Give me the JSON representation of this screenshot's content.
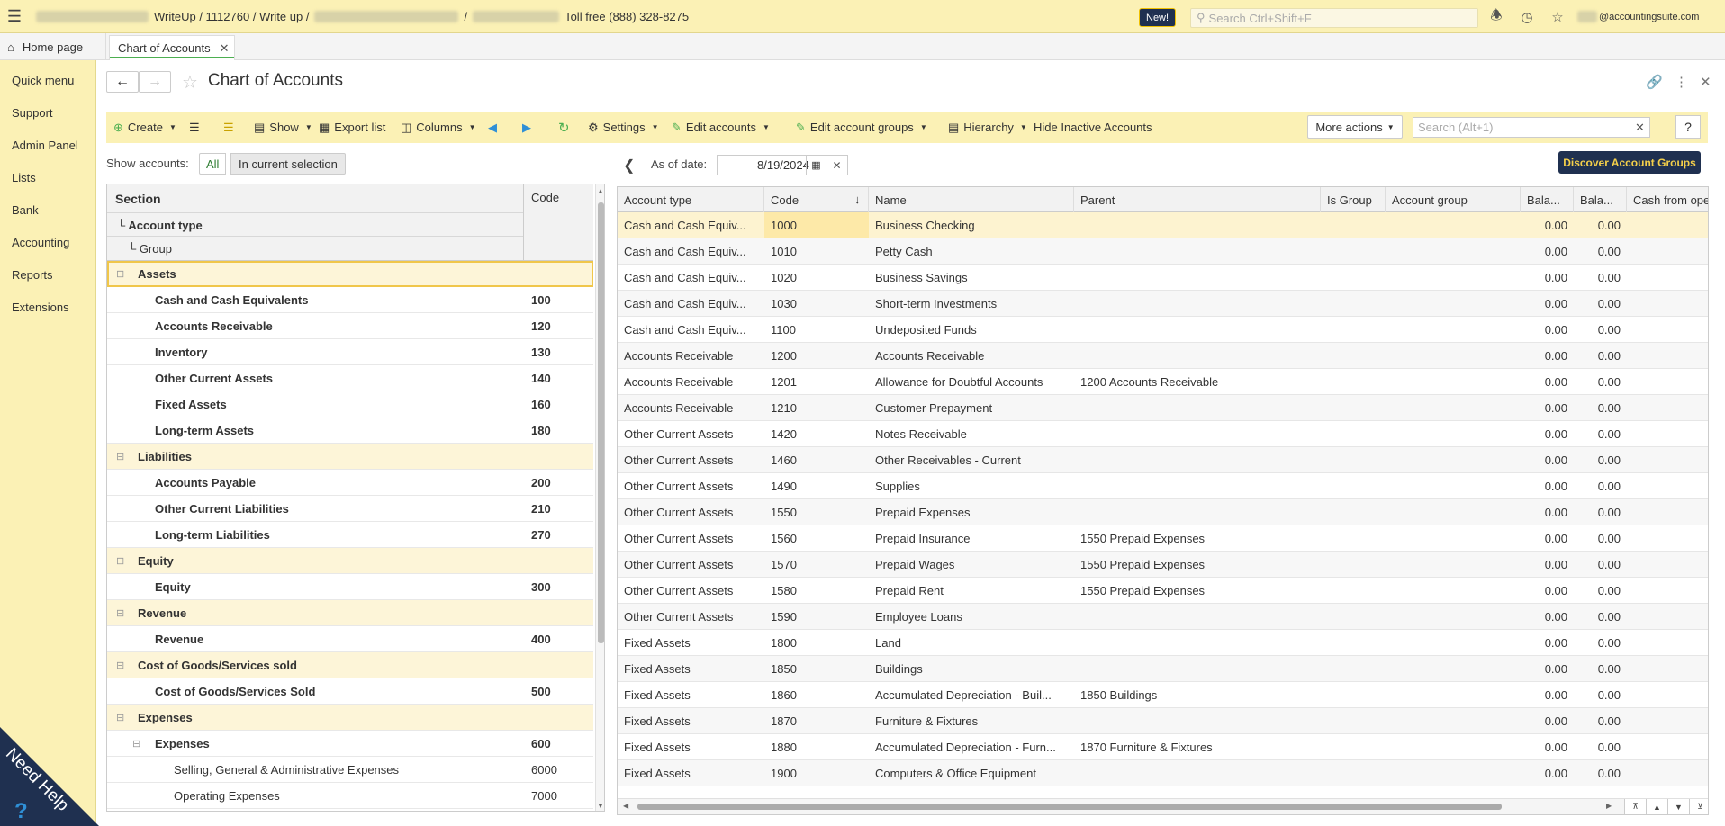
{
  "topbar": {
    "breadcrumb_app": "WriteUp / 1112760 / Write up /",
    "breadcrumb_sep": "/",
    "phone": "Toll free (888) 328-8275",
    "new_badge": "New!",
    "search_placeholder": "Search Ctrl+Shift+F",
    "user_email": "@accountingsuite.com"
  },
  "tabs": {
    "home": "Home page",
    "active": "Chart of Accounts"
  },
  "sidebar": {
    "items": [
      "Quick menu",
      "Support",
      "Admin Panel",
      "Lists",
      "Bank",
      "Accounting",
      "Reports",
      "Extensions"
    ],
    "need_help": "Need Help",
    "need_help_q": "?"
  },
  "page": {
    "title": "Chart of Accounts"
  },
  "toolbar": {
    "create": "Create",
    "show": "Show",
    "export_list": "Export list",
    "columns": "Columns",
    "settings": "Settings",
    "edit_accounts": "Edit accounts",
    "edit_account_groups": "Edit account groups",
    "hierarchy": "Hierarchy",
    "hide_inactive": "Hide Inactive Accounts",
    "more_actions": "More actions",
    "search_placeholder": "Search (Alt+1)",
    "help": "?"
  },
  "show_accounts": {
    "label": "Show accounts:",
    "all": "All",
    "in_current_selection": "In current selection"
  },
  "left_table": {
    "header_section": "Section",
    "header_code": "Code",
    "header_account_type": "└ Account type",
    "header_group": "└ Group",
    "rows": [
      {
        "name": "Assets",
        "code": "",
        "level": 0,
        "bold": true,
        "toggle": "⊟"
      },
      {
        "name": "Cash and Cash Equivalents",
        "code": "100",
        "level": 1,
        "bold": true,
        "toggle": ""
      },
      {
        "name": "Accounts Receivable",
        "code": "120",
        "level": 1,
        "bold": true,
        "toggle": ""
      },
      {
        "name": "Inventory",
        "code": "130",
        "level": 1,
        "bold": true,
        "toggle": ""
      },
      {
        "name": "Other Current Assets",
        "code": "140",
        "level": 1,
        "bold": true,
        "toggle": ""
      },
      {
        "name": "Fixed Assets",
        "code": "160",
        "level": 1,
        "bold": true,
        "toggle": ""
      },
      {
        "name": "Long-term Assets",
        "code": "180",
        "level": 1,
        "bold": true,
        "toggle": ""
      },
      {
        "name": "Liabilities",
        "code": "",
        "level": 0,
        "bold": true,
        "toggle": "⊟"
      },
      {
        "name": "Accounts Payable",
        "code": "200",
        "level": 1,
        "bold": true,
        "toggle": ""
      },
      {
        "name": "Other Current Liabilities",
        "code": "210",
        "level": 1,
        "bold": true,
        "toggle": ""
      },
      {
        "name": "Long-term Liabilities",
        "code": "270",
        "level": 1,
        "bold": true,
        "toggle": ""
      },
      {
        "name": "Equity",
        "code": "",
        "level": 0,
        "bold": true,
        "toggle": "⊟"
      },
      {
        "name": "Equity",
        "code": "300",
        "level": 1,
        "bold": true,
        "toggle": ""
      },
      {
        "name": "Revenue",
        "code": "",
        "level": 0,
        "bold": true,
        "toggle": "⊟"
      },
      {
        "name": "Revenue",
        "code": "400",
        "level": 1,
        "bold": true,
        "toggle": ""
      },
      {
        "name": "Cost of Goods/Services sold",
        "code": "",
        "level": 0,
        "bold": true,
        "toggle": "⊟"
      },
      {
        "name": "Cost of Goods/Services Sold",
        "code": "500",
        "level": 1,
        "bold": true,
        "toggle": ""
      },
      {
        "name": "Expenses",
        "code": "",
        "level": 0,
        "bold": true,
        "toggle": "⊟"
      },
      {
        "name": "Expenses",
        "code": "600",
        "level": 1,
        "bold": true,
        "toggle": "⊟"
      },
      {
        "name": "Selling, General & Administrative Expenses",
        "code": "6000",
        "level": 2,
        "bold": false,
        "toggle": ""
      },
      {
        "name": "Operating Expenses",
        "code": "7000",
        "level": 2,
        "bold": false,
        "toggle": ""
      }
    ]
  },
  "right_panel": {
    "as_of_label": "As of date:",
    "as_of_date": "8/19/2024",
    "discover": "Discover Account Groups",
    "columns": [
      "Account type",
      "Code",
      "Name",
      "Parent",
      "Is Group",
      "Account group",
      "Bala...",
      "Bala...",
      "Cash from ope"
    ],
    "sort_indicator": "↓",
    "rows": [
      {
        "type": "Cash and Cash Equiv...",
        "code": "1000",
        "name": "Business Checking",
        "parent": "",
        "bal1": "0.00",
        "bal2": "0.00"
      },
      {
        "type": "Cash and Cash Equiv...",
        "code": "1010",
        "name": "Petty Cash",
        "parent": "",
        "bal1": "0.00",
        "bal2": "0.00"
      },
      {
        "type": "Cash and Cash Equiv...",
        "code": "1020",
        "name": "Business Savings",
        "parent": "",
        "bal1": "0.00",
        "bal2": "0.00"
      },
      {
        "type": "Cash and Cash Equiv...",
        "code": "1030",
        "name": "Short-term Investments",
        "parent": "",
        "bal1": "0.00",
        "bal2": "0.00"
      },
      {
        "type": "Cash and Cash Equiv...",
        "code": "1100",
        "name": "Undeposited Funds",
        "parent": "",
        "bal1": "0.00",
        "bal2": "0.00"
      },
      {
        "type": "Accounts Receivable",
        "code": "1200",
        "name": "Accounts Receivable",
        "parent": "",
        "bal1": "0.00",
        "bal2": "0.00"
      },
      {
        "type": "Accounts Receivable",
        "code": "1201",
        "name": "Allowance for Doubtful Accounts",
        "parent": "1200 Accounts Receivable",
        "bal1": "0.00",
        "bal2": "0.00"
      },
      {
        "type": "Accounts Receivable",
        "code": "1210",
        "name": "Customer Prepayment",
        "parent": "",
        "bal1": "0.00",
        "bal2": "0.00"
      },
      {
        "type": "Other Current Assets",
        "code": "1420",
        "name": "Notes Receivable",
        "parent": "",
        "bal1": "0.00",
        "bal2": "0.00"
      },
      {
        "type": "Other Current Assets",
        "code": "1460",
        "name": "Other Receivables - Current",
        "parent": "",
        "bal1": "0.00",
        "bal2": "0.00"
      },
      {
        "type": "Other Current Assets",
        "code": "1490",
        "name": "Supplies",
        "parent": "",
        "bal1": "0.00",
        "bal2": "0.00"
      },
      {
        "type": "Other Current Assets",
        "code": "1550",
        "name": "Prepaid Expenses",
        "parent": "",
        "bal1": "0.00",
        "bal2": "0.00"
      },
      {
        "type": "Other Current Assets",
        "code": "1560",
        "name": "Prepaid Insurance",
        "parent": "1550 Prepaid Expenses",
        "bal1": "0.00",
        "bal2": "0.00"
      },
      {
        "type": "Other Current Assets",
        "code": "1570",
        "name": "Prepaid Wages",
        "parent": "1550 Prepaid Expenses",
        "bal1": "0.00",
        "bal2": "0.00"
      },
      {
        "type": "Other Current Assets",
        "code": "1580",
        "name": "Prepaid Rent",
        "parent": "1550 Prepaid Expenses",
        "bal1": "0.00",
        "bal2": "0.00"
      },
      {
        "type": "Other Current Assets",
        "code": "1590",
        "name": "Employee Loans",
        "parent": "",
        "bal1": "0.00",
        "bal2": "0.00"
      },
      {
        "type": "Fixed Assets",
        "code": "1800",
        "name": "Land",
        "parent": "",
        "bal1": "0.00",
        "bal2": "0.00"
      },
      {
        "type": "Fixed Assets",
        "code": "1850",
        "name": "Buildings",
        "parent": "",
        "bal1": "0.00",
        "bal2": "0.00"
      },
      {
        "type": "Fixed Assets",
        "code": "1860",
        "name": "Accumulated Depreciation - Buil...",
        "parent": "1850 Buildings",
        "bal1": "0.00",
        "bal2": "0.00"
      },
      {
        "type": "Fixed Assets",
        "code": "1870",
        "name": "Furniture & Fixtures",
        "parent": "",
        "bal1": "0.00",
        "bal2": "0.00"
      },
      {
        "type": "Fixed Assets",
        "code": "1880",
        "name": "Accumulated Depreciation - Furn...",
        "parent": "1870 Furniture & Fixtures",
        "bal1": "0.00",
        "bal2": "0.00"
      },
      {
        "type": "Fixed Assets",
        "code": "1900",
        "name": "Computers & Office Equipment",
        "parent": "",
        "bal1": "0.00",
        "bal2": "0.00"
      }
    ]
  },
  "colors": {
    "top_bar": "#fbf1b5",
    "sidebar": "#fbf1b5",
    "navy": "#1f3050",
    "accent_green": "#4caf50",
    "selection": "#fdf3d0"
  }
}
